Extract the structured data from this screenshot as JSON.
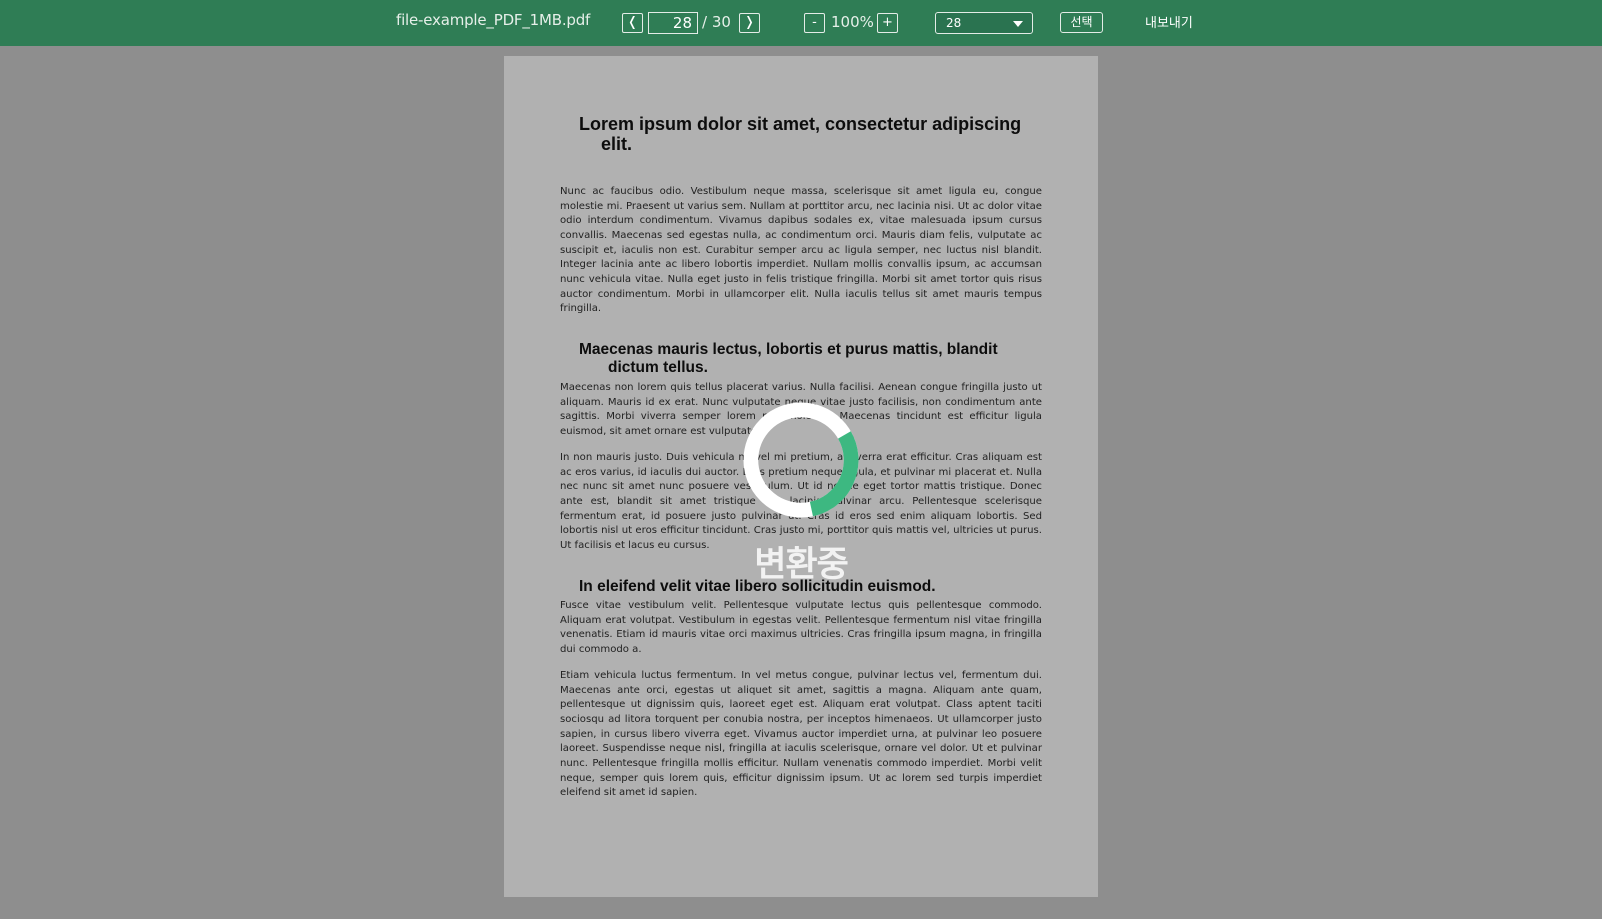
{
  "toolbar": {
    "file_name": "file-example_PDF_1MB.pdf",
    "prev_label": "❬",
    "next_label": "❭",
    "current_page": "28",
    "page_total": "/ 30",
    "zoom_out_label": "-",
    "zoom_level": "100%",
    "zoom_in_label": "+",
    "page_select_value": "28",
    "select_label": "선택",
    "export_label": "내보내기"
  },
  "document": {
    "heading1_line1": "Lorem ipsum dolor sit amet, consectetur adipiscing",
    "heading1_line2": "elit.",
    "para1": "Nunc ac faucibus odio. Vestibulum neque massa, scelerisque sit amet ligula eu, congue molestie mi. Praesent ut varius sem. Nullam at porttitor arcu, nec lacinia nisi. Ut ac dolor vitae odio interdum condimentum. Vivamus dapibus sodales ex, vitae malesuada ipsum cursus convallis. Maecenas sed egestas nulla, ac condimentum orci. Mauris diam felis, vulputate ac suscipit et, iaculis non est. Curabitur semper arcu ac ligula semper, nec luctus nisl blandit. Integer lacinia ante ac libero lobortis imperdiet. Nullam mollis convallis ipsum, ac accumsan nunc vehicula vitae. Nulla eget justo in felis tristique fringilla. Morbi sit amet tortor quis risus auctor condimentum. Morbi in ullamcorper elit. Nulla iaculis tellus sit amet mauris tempus fringilla.",
    "heading2_line1": "Maecenas mauris lectus, lobortis et purus mattis, blandit",
    "heading2_line2": "dictum tellus.",
    "para2": "Maecenas non lorem quis tellus placerat varius. Nulla facilisi. Aenean congue fringilla justo ut aliquam. Mauris id ex erat. Nunc vulputate neque vitae justo facilisis, non condimentum ante sagittis. Morbi viverra semper lorem nec molestie. Maecenas tincidunt est efficitur ligula euismod, sit amet ornare est vulputate.",
    "para3": "In non mauris justo. Duis vehicula mi vel mi pretium, a viverra erat efficitur. Cras aliquam est ac eros varius, id iaculis dui auctor. Duis pretium neque ligula, et pulvinar mi placerat et. Nulla nec nunc sit amet nunc posuere vestibulum. Ut id neque eget tortor mattis tristique. Donec ante est, blandit sit amet tristique vel, lacinia pulvinar arcu. Pellentesque scelerisque fermentum erat, id posuere justo pulvinar ut. Cras id eros sed enim aliquam lobortis. Sed lobortis nisl ut eros efficitur tincidunt. Cras justo mi, porttitor quis mattis vel, ultricies ut purus. Ut facilisis et lacus eu cursus.",
    "heading3": "In eleifend velit vitae libero sollicitudin euismod.",
    "para4": "Fusce vitae vestibulum velit. Pellentesque vulputate lectus quis pellentesque commodo. Aliquam erat volutpat. Vestibulum in egestas velit. Pellentesque fermentum nisl vitae fringilla venenatis. Etiam id mauris vitae orci maximus ultricies. Cras fringilla ipsum magna, in fringilla dui commodo a.",
    "para5": "Etiam vehicula luctus fermentum. In vel metus congue, pulvinar lectus vel, fermentum dui. Maecenas ante orci, egestas ut aliquet sit amet, sagittis a magna. Aliquam ante quam, pellentesque ut dignissim quis, laoreet eget est. Aliquam erat volutpat. Class aptent taciti sociosqu ad litora torquent per conubia nostra, per inceptos himenaeos. Ut ullamcorper justo sapien, in cursus libero viverra eget. Vivamus auctor imperdiet urna, at pulvinar leo posuere laoreet. Suspendisse neque nisl, fringilla at iaculis scelerisque, ornare vel dolor. Ut et pulvinar nunc. Pellentesque fringilla mollis efficitur. Nullam venenatis commodo imperdiet. Morbi velit neque, semper quis lorem quis, efficitur dignissim ipsum. Ut ac lorem sed turpis imperdiet eleifend sit amet id sapien."
  },
  "loading": {
    "text": "변환중",
    "progress_fraction": 0.3,
    "ring_color": "#ffffff",
    "progress_color": "#3db881"
  },
  "colors": {
    "toolbar_bg": "#2f7d55",
    "backdrop": "#8e8e8e",
    "page_bg": "#b1b1b1"
  }
}
